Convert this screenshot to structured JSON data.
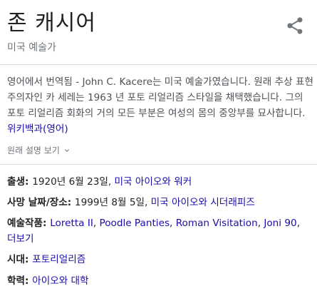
{
  "entity": {
    "title": "존 캐시어",
    "subtitle": "미국 예술가"
  },
  "icons": {
    "share": "share-icon",
    "expand": "chevron-down-icon"
  },
  "description": {
    "source_label": "영어에서 번역됨",
    "separator": " - ",
    "text": "John C. Kacere는 미국 예술가였습니다. 원래 추상 표현주의자인 카 세레는 1963 년 포토 리얼리즘 스타일을 채택했습니다. 그의 포토 리얼리즘 회화의 거의 모든 부분은 여성의 몸의 중앙부를 묘사합니다.",
    "wiki_link": "위키백과(영어)"
  },
  "more_link": "원래 설명 보기",
  "facts": {
    "born": {
      "label": "출생",
      "sep": ": ",
      "value": "1920년 6월 23일, ",
      "link": "미국 아이오와 워커"
    },
    "died": {
      "label": "사망 날짜/장소",
      "sep": ": ",
      "value": "1999년 8월 5일, ",
      "link": "미국 아이오와 시더래피즈"
    },
    "artworks": {
      "label": "예술작품",
      "sep": ": ",
      "items": [
        "Loretta II",
        "Poodle Panties",
        "Roman Visitation",
        "Joni 90"
      ],
      "more": "더보기"
    },
    "period": {
      "label": "시대",
      "sep": ": ",
      "link": "포토리얼리즘"
    },
    "education": {
      "label": "학력",
      "sep": ": ",
      "link": "아이오와 대학"
    }
  },
  "colors": {
    "link": "#1a0dab",
    "text": "#202124",
    "muted": "#70757a",
    "divider": "#dadce0"
  }
}
